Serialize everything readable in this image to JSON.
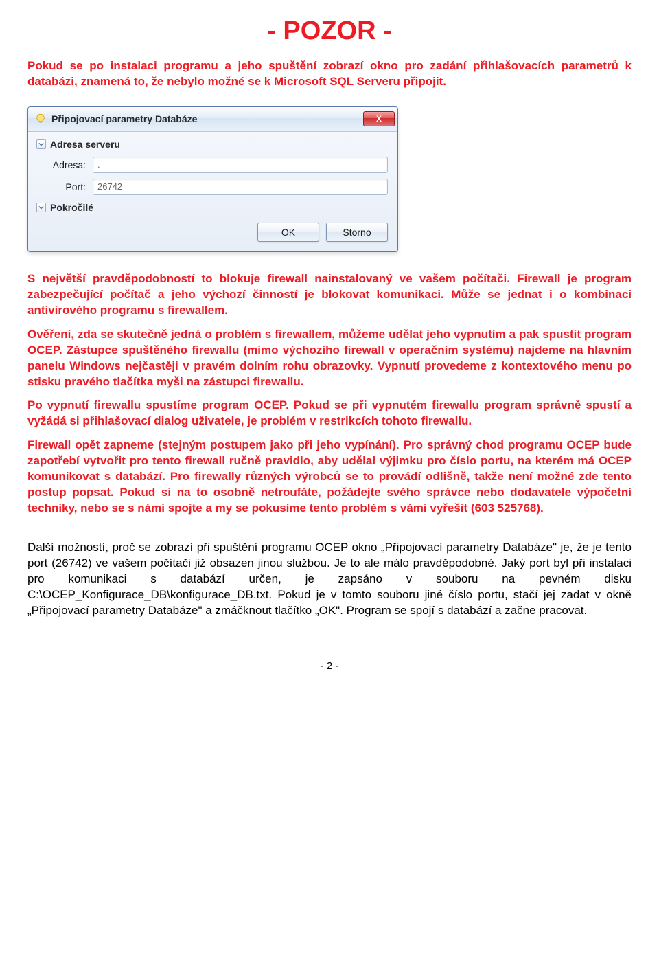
{
  "heading": "- POZOR -",
  "intro": "Pokud se po instalaci programu a jeho spuštění zobrazí okno pro zadání přihlašovacích parametrů k databázi, znamená to, že nebylo možné se k Microsoft SQL Serveru připojit.",
  "dialog": {
    "title": "Připojovací parametry Databáze",
    "section_server": "Adresa serveru",
    "label_address": "Adresa:",
    "value_address": ".",
    "label_port": "Port:",
    "value_port": "26742",
    "section_advanced": "Pokročilé",
    "btn_ok": "OK",
    "btn_storno": "Storno",
    "close_x": "X"
  },
  "p2": "S největší pravděpodobností to blokuje firewall nainstalovaný ve vašem počítači. Firewall je program zabezpečující počítač a jeho výchozí činností je blokovat komunikaci. Může se jednat i o kombinaci antivirového programu s firewallem.",
  "p3": "Ověření, zda se skutečně jedná o problém s firewallem, můžeme udělat jeho vypnutím a pak spustit program OCEP. Zástupce spuštěného firewallu (mimo výchozího firewall v operačním systému) najdeme na hlavním panelu Windows nejčastěji v pravém dolním rohu obrazovky. Vypnutí provedeme z kontextového menu po stisku pravého tlačítka myši na zástupci firewallu.",
  "p4": "Po vypnutí firewallu spustíme program OCEP. Pokud se při vypnutém firewallu program správně spustí a vyžádá si přihlašovací dialog uživatele, je problém v restrikcích tohoto firewallu.",
  "p5": "Firewall opět zapneme (stejným postupem jako při jeho vypínání). Pro správný chod programu OCEP bude zapotřebí vytvořit pro tento firewall ručně pravidlo, aby udělal výjimku pro číslo portu, na kterém má OCEP komunikovat s databází. Pro firewally různých výrobců se to provádí odlišně, takže není možné zde tento postup popsat. Pokud si na to osobně netroufáte, požádejte svého správce nebo dodavatele výpočetní techniky, nebo se s námi spojte a my se pokusíme tento problém s vámi vyřešit (603 525768).",
  "p6": "Další možností, proč se zobrazí při spuštění programu OCEP okno „Připojovací parametry Databáze\" je, že je tento port (26742) ve vašem počítači již obsazen jinou službou. Je to ale málo pravděpodobné. Jaký port byl při instalaci pro komunikaci s databází určen, je zapsáno v souboru na pevném disku C:\\OCEP_Konfigurace_DB\\konfigurace_DB.txt. Pokud je v tomto souboru jiné číslo portu, stačí jej zadat v okně „Připojovací parametry Databáze\" a zmáčknout tlačítko „OK\". Program se spojí s databází a začne pracovat.",
  "page_number": "- 2 -"
}
